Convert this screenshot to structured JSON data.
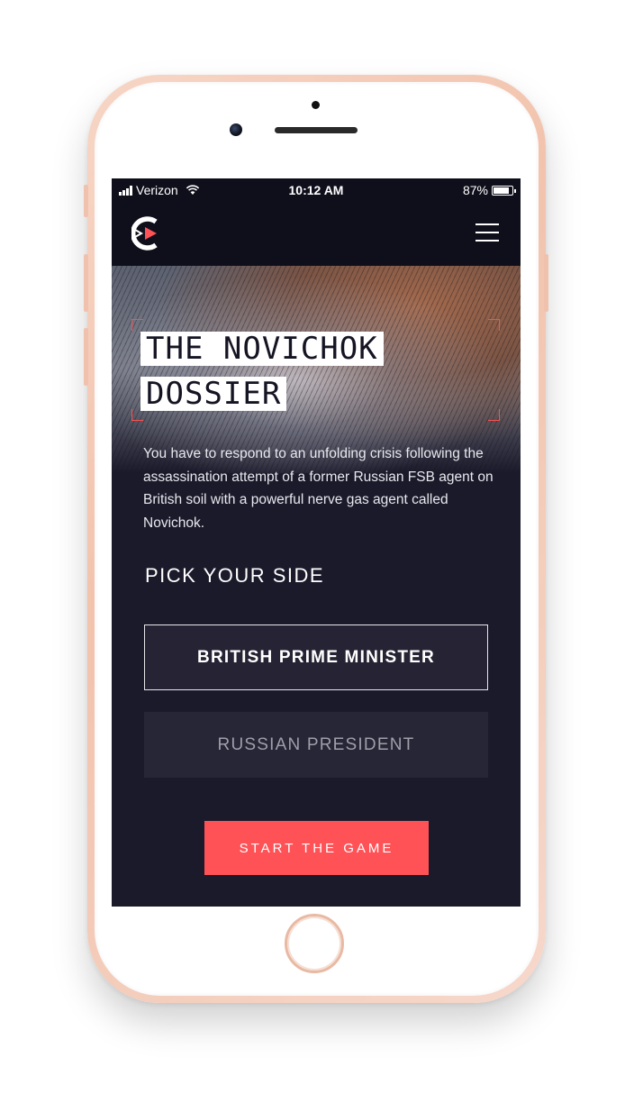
{
  "status_bar": {
    "carrier": "Verizon",
    "time": "10:12 AM",
    "battery_percent": "87%",
    "battery_level": 0.87
  },
  "nav": {
    "logo_icon": "brand-logo-icon",
    "menu_icon": "hamburger-menu-icon"
  },
  "hero": {
    "title_line_1": "THE NOVICHOK",
    "title_line_2": "DOSSIER",
    "description": "You have to respond to an unfolding crisis following the assassination attempt of a former Russian FSB agent on British soil with a powerful nerve gas agent called Novichok."
  },
  "pick_side": {
    "heading": "PICK YOUR SIDE",
    "options": [
      {
        "label": "BRITISH PRIME MINISTER",
        "selected": true
      },
      {
        "label": "RUSSIAN PRESIDENT",
        "selected": false
      }
    ]
  },
  "start_button": {
    "label": "START THE GAME"
  },
  "colors": {
    "accent": "#ff5257",
    "background": "#1b1a2b",
    "navbar": "#0f0f1c"
  }
}
